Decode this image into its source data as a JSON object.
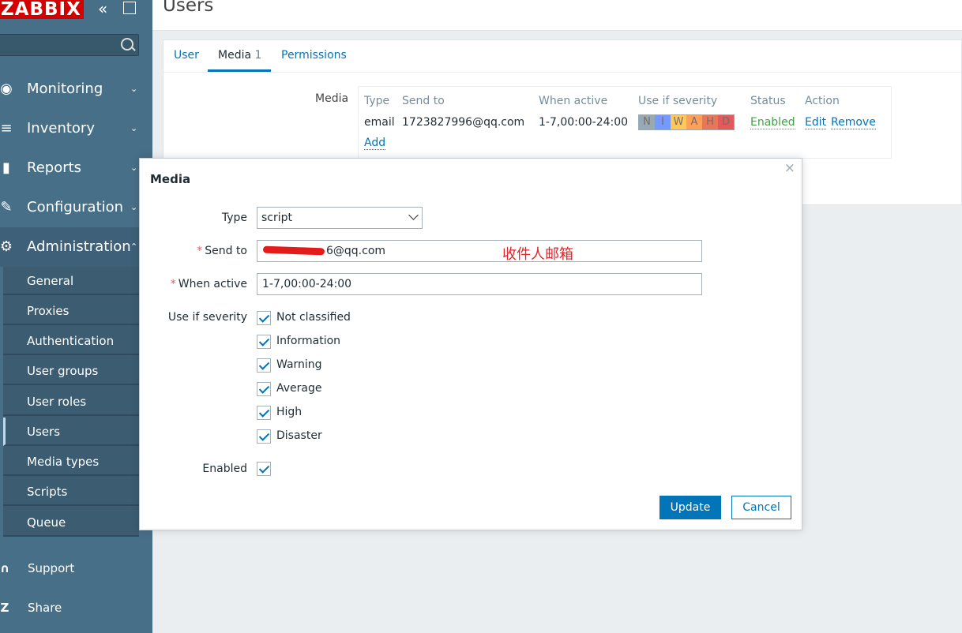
{
  "sidebar": {
    "logo": "ZABBIX",
    "menu": [
      {
        "icon": "eye-icon",
        "label": "Monitoring"
      },
      {
        "icon": "list-icon",
        "label": "Inventory"
      },
      {
        "icon": "bar-chart-icon",
        "label": "Reports"
      },
      {
        "icon": "wrench-icon",
        "label": "Configuration"
      },
      {
        "icon": "gear-icon",
        "label": "Administration"
      }
    ],
    "submenu": [
      "General",
      "Proxies",
      "Authentication",
      "User groups",
      "User roles",
      "Users",
      "Media types",
      "Scripts",
      "Queue"
    ],
    "bottom": [
      {
        "icon": "headset-icon",
        "label": "Support"
      },
      {
        "icon": "share-icon",
        "label": "Share"
      }
    ]
  },
  "header": {
    "title": "Users"
  },
  "tabs": [
    {
      "label": "User"
    },
    {
      "label": "Media",
      "count": "1"
    },
    {
      "label": "Permissions"
    }
  ],
  "media": {
    "label": "Media",
    "columns": [
      "Type",
      "Send to",
      "When active",
      "Use if severity",
      "Status",
      "Action"
    ],
    "row": {
      "type": "email",
      "send_to": "1723827996@qq.com",
      "when_active": "1-7,00:00-24:00",
      "severity_letters": [
        "N",
        "I",
        "W",
        "A",
        "H",
        "D"
      ],
      "status": "Enabled",
      "edit": "Edit",
      "remove": "Remove"
    },
    "add": "Add"
  },
  "dialog": {
    "title": "Media",
    "close": "×",
    "type_label": "Type",
    "type_value": "script",
    "send_to_label": "Send to",
    "send_to_value": "6@qq.com",
    "annotation": "收件人邮箱",
    "when_active_label": "When active",
    "when_active_value": "1-7,00:00-24:00",
    "severity_label": "Use if severity",
    "severities": [
      "Not classified",
      "Information",
      "Warning",
      "Average",
      "High",
      "Disaster"
    ],
    "enabled_label": "Enabled",
    "update": "Update",
    "cancel": "Cancel"
  },
  "colors": {
    "sidebar": "#486f88",
    "accent": "#0275b8",
    "enabled": "#429e47",
    "sev_not_classified": "#97aab3",
    "sev_information": "#7499ff",
    "sev_warning": "#ffc859",
    "sev_average": "#ffa059",
    "sev_high": "#e97659",
    "sev_disaster": "#e45959"
  }
}
